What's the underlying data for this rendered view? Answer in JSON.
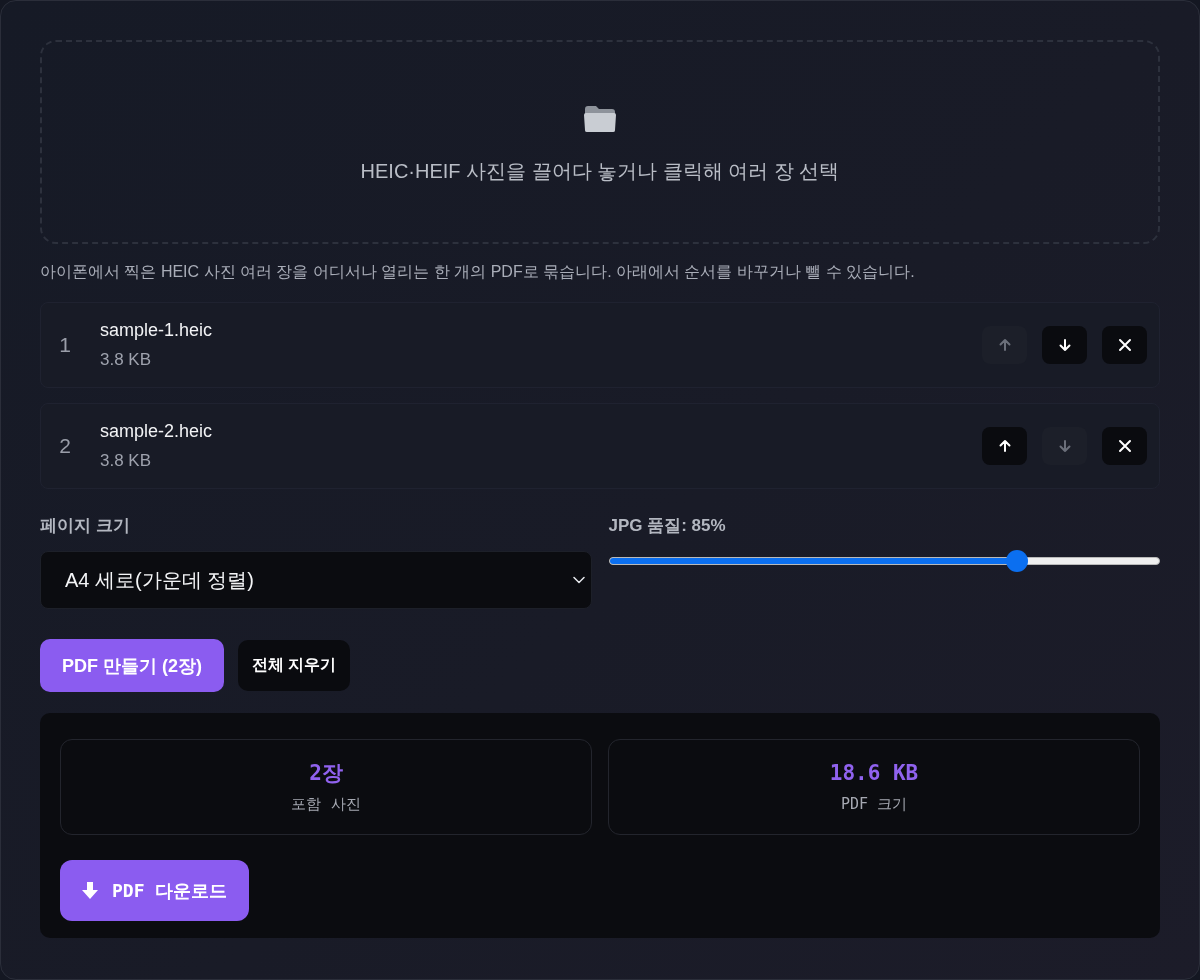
{
  "dropzone": {
    "text": "HEIC·HEIF 사진을 끌어다 놓거나 클릭해 여러 장 선택"
  },
  "description": "아이폰에서 찍은 HEIC 사진 여러 장을 어디서나 열리는 한 개의 PDF로 묶습니다. 아래에서 순서를 바꾸거나 뺄 수 있습니다.",
  "files": [
    {
      "number": "1",
      "name": "sample-1.heic",
      "size": "3.8 KB",
      "controls": [
        {
          "kind": "up",
          "disabled": true
        },
        {
          "kind": "down",
          "disabled": false
        },
        {
          "kind": "remove",
          "disabled": false
        }
      ]
    },
    {
      "number": "2",
      "name": "sample-2.heic",
      "size": "3.8 KB",
      "controls": [
        {
          "kind": "up",
          "disabled": false
        },
        {
          "kind": "down",
          "disabled": true
        },
        {
          "kind": "remove",
          "disabled": false
        }
      ]
    }
  ],
  "page_size": {
    "label": "페이지 크기",
    "value": "A4 세로(가운데 정렬)"
  },
  "quality": {
    "label": "JPG 품질: 85%",
    "level": 0.75
  },
  "actions": [
    {
      "label": "PDF 만들기 (2장)",
      "kind": "primary"
    },
    {
      "label": "전체 지우기",
      "kind": "secondary"
    }
  ],
  "result": {
    "stats": [
      {
        "value": "2장",
        "label": "포함 사진"
      },
      {
        "value": "18.6 KB",
        "label": "PDF 크기"
      }
    ],
    "download": {
      "label": "PDF 다운로드"
    }
  }
}
